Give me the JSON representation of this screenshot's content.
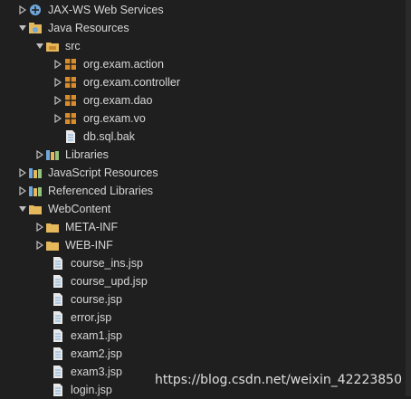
{
  "tree": {
    "items": [
      {
        "label": "JAX-WS Web Services",
        "expanded": false,
        "icon": "jaxws-icon"
      },
      {
        "label": "Java Resources",
        "expanded": true,
        "icon": "java-resources-icon"
      },
      {
        "label": "src",
        "expanded": true,
        "icon": "source-folder-icon"
      },
      {
        "label": "org.exam.action",
        "expanded": false,
        "icon": "package-icon"
      },
      {
        "label": "org.exam.controller",
        "expanded": false,
        "icon": "package-icon"
      },
      {
        "label": "org.exam.dao",
        "expanded": false,
        "icon": "package-icon"
      },
      {
        "label": "org.exam.vo",
        "expanded": false,
        "icon": "package-icon"
      },
      {
        "label": "db.sql.bak",
        "expanded": null,
        "icon": "file-icon"
      },
      {
        "label": "Libraries",
        "expanded": false,
        "icon": "libraries-icon"
      },
      {
        "label": "JavaScript Resources",
        "expanded": false,
        "icon": "javascript-resources-icon"
      },
      {
        "label": "Referenced Libraries",
        "expanded": false,
        "icon": "referenced-libraries-icon"
      },
      {
        "label": "WebContent",
        "expanded": true,
        "icon": "folder-open-icon"
      },
      {
        "label": "META-INF",
        "expanded": false,
        "icon": "folder-icon"
      },
      {
        "label": "WEB-INF",
        "expanded": false,
        "icon": "folder-icon"
      },
      {
        "label": "course_ins.jsp",
        "expanded": null,
        "icon": "jsp-file-icon"
      },
      {
        "label": "course_upd.jsp",
        "expanded": null,
        "icon": "jsp-file-icon"
      },
      {
        "label": "course.jsp",
        "expanded": null,
        "icon": "jsp-file-icon"
      },
      {
        "label": "error.jsp",
        "expanded": null,
        "icon": "jsp-file-icon"
      },
      {
        "label": "exam1.jsp",
        "expanded": null,
        "icon": "jsp-file-icon"
      },
      {
        "label": "exam2.jsp",
        "expanded": null,
        "icon": "jsp-file-icon"
      },
      {
        "label": "exam3.jsp",
        "expanded": null,
        "icon": "jsp-file-icon"
      },
      {
        "label": "login.jsp",
        "expanded": null,
        "icon": "jsp-file-icon"
      }
    ]
  },
  "watermark": "https://blog.csdn.net/weixin_42223850",
  "colors": {
    "background": "#1f1f1f",
    "text": "#d7d7d7",
    "package": "#d98c2b",
    "folder": "#e6b85c"
  }
}
